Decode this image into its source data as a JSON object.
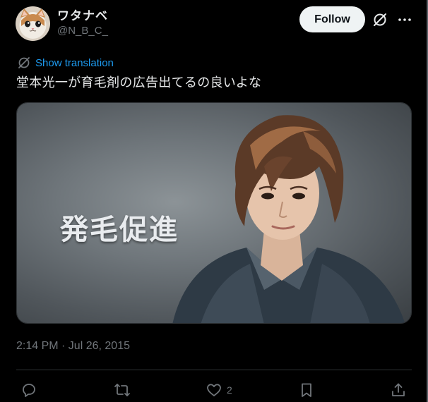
{
  "author": {
    "display_name": "ワタナベ",
    "handle": "@N_B_C_"
  },
  "header": {
    "follow_label": "Follow"
  },
  "tweet": {
    "translation_label": "Show translation",
    "text": "堂本光一が育毛剤の広告出てるの良いよな",
    "media_caption": "発毛促進",
    "timestamp": "2:14 PM · Jul 26, 2015"
  },
  "actions": {
    "reply_count": "",
    "repost_count": "",
    "like_count": "2",
    "bookmark_count": "",
    "share_count": ""
  },
  "icons": {
    "avatar": "cat-avatar",
    "grok": "grok-icon",
    "more": "more-horizontal-icon",
    "translate": "translate-icon",
    "reply": "reply-icon",
    "repost": "repost-icon",
    "like": "heart-icon",
    "bookmark": "bookmark-icon",
    "share": "share-icon"
  },
  "colors": {
    "background": "#000000",
    "text_primary": "#e7e9ea",
    "text_secondary": "#71767b",
    "link": "#1d9bf0",
    "follow_bg": "#eff3f4",
    "divider": "#2f3336"
  }
}
